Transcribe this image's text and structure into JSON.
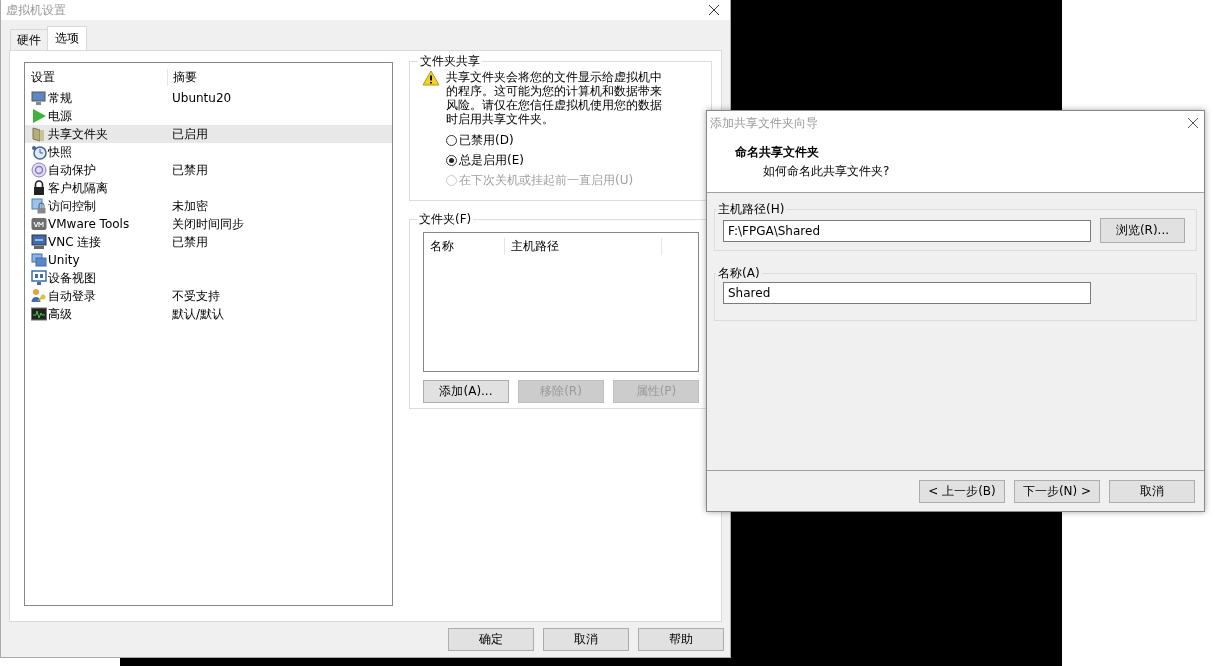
{
  "settings_window": {
    "title": "虚拟机设置",
    "tabs": [
      {
        "label": "硬件",
        "selected": false
      },
      {
        "label": "选项",
        "selected": true
      }
    ],
    "settings_list": {
      "columns": [
        "设置",
        "摘要"
      ],
      "rows": [
        {
          "kind": "monitor",
          "name": "常规",
          "summary": "Ubuntu20",
          "selected": false
        },
        {
          "kind": "power",
          "name": "电源",
          "selected": false
        },
        {
          "kind": "folder",
          "name": "共享文件夹",
          "summary": "已启用",
          "selected": true
        },
        {
          "kind": "snapshot",
          "name": "快照",
          "selected": false
        },
        {
          "kind": "autoprotect",
          "name": "自动保护",
          "summary": "已禁用",
          "selected": false
        },
        {
          "kind": "lock",
          "name": "客户机隔离",
          "selected": false
        },
        {
          "kind": "access",
          "name": "访问控制",
          "summary": "未加密",
          "selected": false
        },
        {
          "kind": "vm",
          "name": "VMware Tools",
          "summary": "关闭时间同步",
          "selected": false
        },
        {
          "kind": "vnc",
          "name": "VNC 连接",
          "summary": "已禁用",
          "selected": false
        },
        {
          "kind": "unity",
          "name": "Unity",
          "selected": false
        },
        {
          "kind": "device",
          "name": "设备视图",
          "selected": false
        },
        {
          "kind": "autologin",
          "name": "自动登录",
          "summary": "不受支持",
          "selected": false
        },
        {
          "kind": "advanced",
          "name": "高级",
          "summary": "默认/默认",
          "selected": false
        }
      ]
    },
    "folder_sharing": {
      "title": "文件夹共享",
      "warning": "共享文件夹会将您的文件显示给虚拟机中的程序。这可能为您的计算机和数据带来风险。请仅在您信任虚拟机使用您的数据时启用共享文件夹。",
      "options": [
        {
          "label": "已禁用(D)",
          "selected": false,
          "disabled": false
        },
        {
          "label": "总是启用(E)",
          "selected": true,
          "disabled": false
        },
        {
          "label": "在下次关机或挂起前一直启用(U)",
          "selected": false,
          "disabled": true
        }
      ]
    },
    "folders": {
      "title": "文件夹(F)",
      "columns": [
        "名称",
        "主机路径"
      ],
      "buttons": [
        {
          "label": "添加(A)...",
          "disabled": false
        },
        {
          "label": "移除(R)",
          "disabled": true
        },
        {
          "label": "属性(P)",
          "disabled": true
        }
      ]
    },
    "buttons": [
      "确定",
      "取消",
      "帮助"
    ]
  },
  "wizard": {
    "title": "添加共享文件夹向导",
    "heading": "命名共享文件夹",
    "subheading": "如何命名此共享文件夹?",
    "host_path": {
      "label": "主机路径(H)",
      "value": "F:\\FPGA\\Shared",
      "browse_button": "浏览(R)..."
    },
    "name": {
      "label": "名称(A)",
      "value": "Shared"
    },
    "buttons": [
      "< 上一步(B)",
      "下一步(N) >",
      "取消"
    ]
  }
}
